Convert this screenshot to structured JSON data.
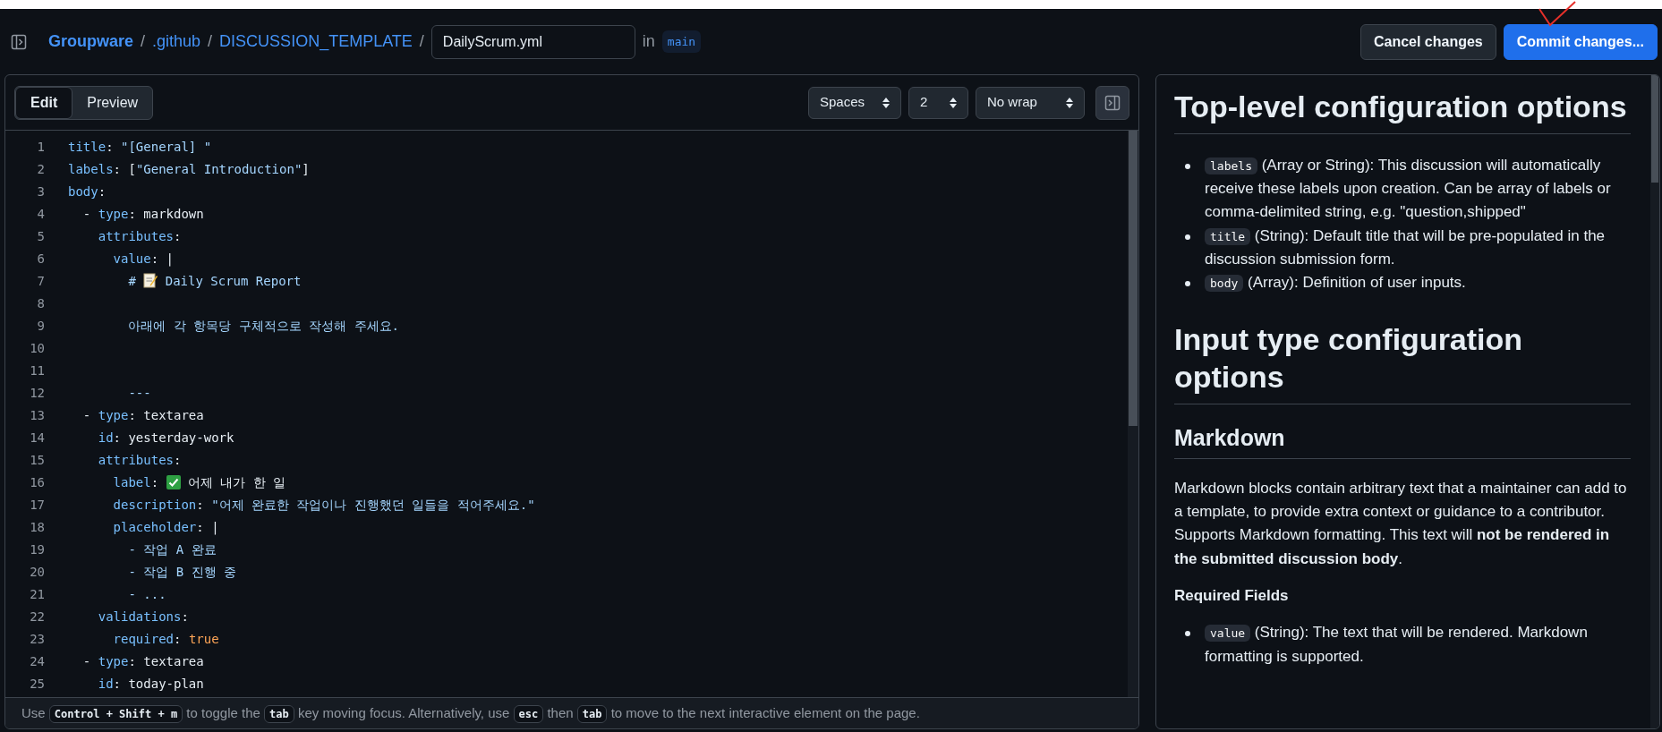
{
  "header": {
    "breadcrumb": [
      {
        "text": "Groupware",
        "bold": true
      },
      {
        "text": "/",
        "kind": "separator"
      },
      {
        "text": ".github",
        "bold": false
      },
      {
        "text": "/",
        "kind": "separator"
      },
      {
        "text": "DISCUSSION_TEMPLATE",
        "bold": false
      },
      {
        "text": "/",
        "kind": "separator"
      }
    ],
    "filename": "DailyScrum.yml",
    "in_label": "in",
    "branch": "main",
    "buttons": [
      {
        "label": "Cancel changes",
        "kind": "secondary"
      },
      {
        "label": "Commit changes...",
        "kind": "primary"
      }
    ]
  },
  "editor": {
    "tabs": [
      {
        "label": "Edit",
        "selected": true
      },
      {
        "label": "Preview",
        "selected": false
      }
    ],
    "selects": [
      "Spaces",
      "2",
      "No wrap"
    ],
    "lines": [
      {
        "number": "1",
        "parts": [
          {
            "kind": "key",
            "text": "title"
          },
          {
            "kind": "punct",
            "text": ": "
          },
          {
            "kind": "string",
            "text": "\"[General] \""
          }
        ]
      },
      {
        "number": "2",
        "parts": [
          {
            "kind": "key",
            "text": "labels"
          },
          {
            "kind": "punct",
            "text": ": ["
          },
          {
            "kind": "string",
            "text": "\"General Introduction\""
          },
          {
            "kind": "punct",
            "text": "]"
          }
        ]
      },
      {
        "number": "3",
        "parts": [
          {
            "kind": "key",
            "text": "body"
          },
          {
            "kind": "punct",
            "text": ":"
          }
        ]
      },
      {
        "number": "4",
        "parts": [
          {
            "kind": "punct",
            "text": "  - "
          },
          {
            "kind": "key",
            "text": "type"
          },
          {
            "kind": "punct",
            "text": ": "
          },
          {
            "kind": "value",
            "text": "markdown"
          }
        ]
      },
      {
        "number": "5",
        "parts": [
          {
            "kind": "key",
            "text": "    attributes"
          },
          {
            "kind": "punct",
            "text": ":"
          }
        ]
      },
      {
        "number": "6",
        "parts": [
          {
            "kind": "key",
            "text": "      value"
          },
          {
            "kind": "punct",
            "text": ": |"
          }
        ]
      },
      {
        "number": "7",
        "parts": [
          {
            "kind": "string",
            "text": "        # "
          },
          {
            "kind": "memo_emoji"
          },
          {
            "kind": "string",
            "text": " Daily Scrum Report"
          }
        ]
      },
      {
        "number": "8"
      },
      {
        "number": "9",
        "parts": [
          {
            "kind": "string",
            "text": "        아래에 각 항목당 구체적으로 작성해 주세요."
          }
        ]
      },
      {
        "number": "10"
      },
      {
        "number": "11"
      },
      {
        "number": "12",
        "parts": [
          {
            "kind": "string",
            "text": "        ---"
          }
        ]
      },
      {
        "number": "13",
        "parts": [
          {
            "kind": "punct",
            "text": "  - "
          },
          {
            "kind": "key",
            "text": "type"
          },
          {
            "kind": "punct",
            "text": ": "
          },
          {
            "kind": "value",
            "text": "textarea"
          }
        ]
      },
      {
        "number": "14",
        "parts": [
          {
            "kind": "key",
            "text": "    id"
          },
          {
            "kind": "punct",
            "text": ": "
          },
          {
            "kind": "value",
            "text": "yesterday-work"
          }
        ]
      },
      {
        "number": "15",
        "parts": [
          {
            "kind": "key",
            "text": "    attributes"
          },
          {
            "kind": "punct",
            "text": ":"
          }
        ]
      },
      {
        "number": "16",
        "parts": [
          {
            "kind": "key",
            "text": "      label"
          },
          {
            "kind": "punct",
            "text": ": "
          },
          {
            "kind": "check_emoji"
          },
          {
            "kind": "value",
            "text": " 어제 내가 한 일"
          }
        ]
      },
      {
        "number": "17",
        "parts": [
          {
            "kind": "key",
            "text": "      description"
          },
          {
            "kind": "punct",
            "text": ": "
          },
          {
            "kind": "string",
            "text": "\"어제 완료한 작업이나 진행했던 일들을 적어주세요.\""
          }
        ]
      },
      {
        "number": "18",
        "parts": [
          {
            "kind": "key",
            "text": "      placeholder"
          },
          {
            "kind": "punct",
            "text": ": |"
          }
        ]
      },
      {
        "number": "19",
        "parts": [
          {
            "kind": "string",
            "text": "        - 작업 A 완료"
          }
        ]
      },
      {
        "number": "20",
        "parts": [
          {
            "kind": "string",
            "text": "        - 작업 B 진행 중"
          }
        ]
      },
      {
        "number": "21",
        "parts": [
          {
            "kind": "string",
            "text": "        - ..."
          }
        ]
      },
      {
        "number": "22",
        "parts": [
          {
            "kind": "key",
            "text": "    validations"
          },
          {
            "kind": "punct",
            "text": ":"
          }
        ]
      },
      {
        "number": "23",
        "parts": [
          {
            "kind": "key",
            "text": "      required"
          },
          {
            "kind": "punct",
            "text": ": "
          },
          {
            "kind": "bool",
            "text": "true"
          }
        ]
      },
      {
        "number": "24",
        "parts": [
          {
            "kind": "punct",
            "text": "  - "
          },
          {
            "kind": "key",
            "text": "type"
          },
          {
            "kind": "punct",
            "text": ": "
          },
          {
            "kind": "value",
            "text": "textarea"
          }
        ]
      },
      {
        "number": "25",
        "parts": [
          {
            "kind": "key",
            "text": "    id"
          },
          {
            "kind": "punct",
            "text": ": "
          },
          {
            "kind": "value",
            "text": "today-plan"
          }
        ]
      }
    ],
    "hint": [
      {
        "kind": "text",
        "text": "Use "
      },
      {
        "kind": "kbd",
        "text": "Control + Shift + m"
      },
      {
        "kind": "text",
        "text": " to toggle the "
      },
      {
        "kind": "kbd",
        "text": "tab"
      },
      {
        "kind": "text",
        "text": " key moving focus. Alternatively, use "
      },
      {
        "kind": "kbd",
        "text": "esc"
      },
      {
        "kind": "text",
        "text": " then "
      },
      {
        "kind": "kbd",
        "text": "tab"
      },
      {
        "kind": "text",
        "text": " to move to the next interactive element on the page."
      }
    ]
  },
  "docs": [
    {
      "kind": "h1",
      "text": "Top-level configuration options"
    },
    {
      "kind": "list",
      "items": [
        {
          "code": "labels",
          "text": " (Array or String): This discussion will automatically receive these labels upon creation. Can be array of labels or comma-delimited string, e.g. \"question,shipped\""
        },
        {
          "code": "title",
          "text": " (String): Default title that will be pre-populated in the discussion submission form."
        },
        {
          "code": "body",
          "text": " (Array): Definition of user inputs."
        }
      ]
    },
    {
      "kind": "h1",
      "text": "Input type configuration options"
    },
    {
      "kind": "h2",
      "text": "Markdown"
    },
    {
      "kind": "p",
      "text": "Markdown blocks contain arbitrary text that a maintainer can add to a template, to provide extra context or guidance to a contributor. Supports Markdown formatting. This text will **not be rendered in the submitted discussion body**."
    },
    {
      "kind": "h3",
      "text": "Required Fields"
    },
    {
      "kind": "list",
      "items": [
        {
          "code": "value",
          "text": " (String): The text that will be rendered. Markdown formatting is supported."
        }
      ]
    }
  ]
}
